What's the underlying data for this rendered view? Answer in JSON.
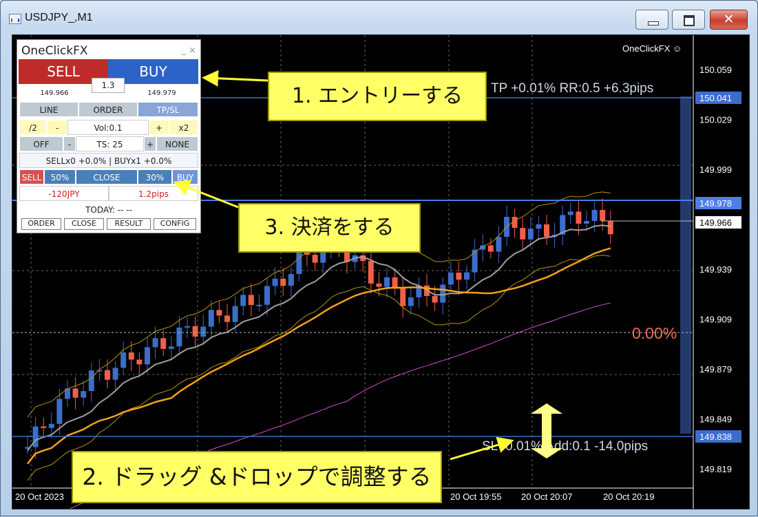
{
  "window": {
    "title": "USDJPY_,M1",
    "min_label": "",
    "max_label": "",
    "close_label": "✕"
  },
  "chart": {
    "brand": "OneClickFX ☺",
    "price_labels": [
      "150.059",
      "150.029",
      "149.999",
      "149.939",
      "149.909",
      "149.879",
      "149.849",
      "149.819"
    ],
    "tp_price_tag": "150.041",
    "buy_price_tag": "149.978",
    "bid_price_tag": "149.966",
    "sl_price_tag": "149.838",
    "tp_text": "TP +0.01% RR:0.5 +6.3pips",
    "sl_text": "SL -0.01% Add:0.1 -14.0pips",
    "pct_text": "0.00%",
    "time_labels": [
      "20 Oct 2023",
      "20 Oct 19:55",
      "20 Oct 20:07",
      "20 Oct 20:19"
    ],
    "colors": {
      "bull": "#3d6dcc",
      "bear": "#f06048",
      "tp_line": "#3d6dcc",
      "buy_line": "#4b7fe6",
      "ma_gray": "#a0a0a0",
      "ma_orange": "#f6a21c",
      "band": "#b8960a",
      "ma_magenta": "#d54bd5",
      "annotation": "#ffff66"
    }
  },
  "panel": {
    "title": "OneClickFX",
    "minclose": "_  ×",
    "sell": "SELL",
    "buy": "BUY",
    "spread": "1.3",
    "sell_price": "149.966",
    "buy_price": "149.979",
    "tabs": [
      "LINE",
      "ORDER",
      "TP/SL"
    ],
    "div2": "/2",
    "minus": "-",
    "vol": "Vol:0.1",
    "plus": "+",
    "x2": "x2",
    "off": "OFF",
    "ts": "TS: 25",
    "none": "NONE",
    "positions": "SELLx0 +0.0% | BUYx1 +0.0%",
    "close_row": [
      "SELL",
      "50%",
      "CLOSE",
      "30%",
      "BUY"
    ],
    "pl_jpy": "-120JPY",
    "pl_pips": "1.2pips",
    "today": "TODAY: -- --",
    "bottom": [
      "ORDER",
      "CLOSE",
      "RESULT",
      "CONFIG"
    ]
  },
  "annotations": {
    "step1": "1. エントリーする",
    "step2": "2. ドラッグ &ドロップで調整する",
    "step3": "3. 決済をする"
  }
}
